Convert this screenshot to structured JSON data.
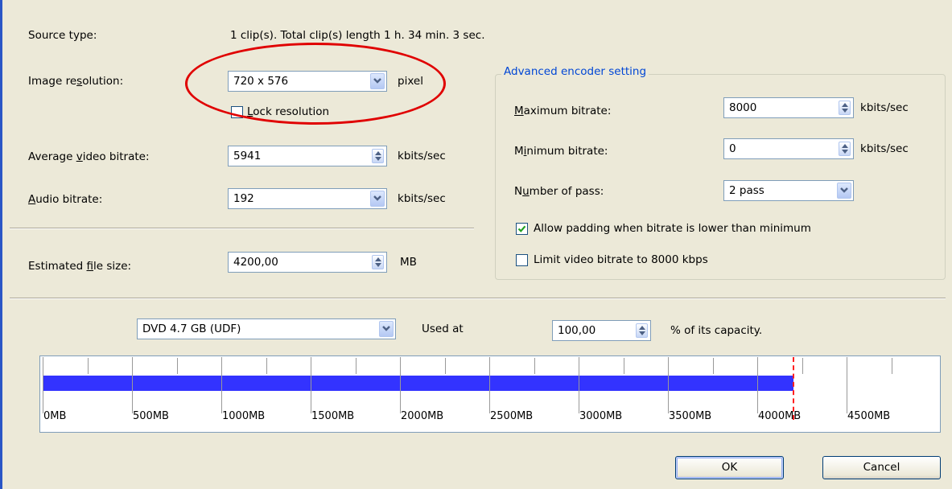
{
  "left": {
    "source_type_label": "Source type:",
    "source_type_value": "1 clip(s).  Total clip(s) length 1 h. 34 min. 3 sec.",
    "resolution_label_pre": "Image re",
    "resolution_label_u": "s",
    "resolution_label_post": "olution:",
    "resolution_value": "720 x 576",
    "resolution_unit": "pixel",
    "lock_label_u": "L",
    "lock_label_rest": "ock resolution",
    "avg_bitrate_label_pre": "Average ",
    "avg_bitrate_label_u": "v",
    "avg_bitrate_label_post": "ideo bitrate:",
    "avg_bitrate_value": "5941",
    "avg_bitrate_unit": "kbits/sec",
    "audio_label_u": "A",
    "audio_label_rest": "udio bitrate:",
    "audio_value": "192",
    "audio_unit": "kbits/sec",
    "filesize_label_pre": "Estimated ",
    "filesize_label_u": "f",
    "filesize_label_post": "ile size:",
    "filesize_value": "4200,00",
    "filesize_unit": "MB"
  },
  "advanced": {
    "title": "Advanced encoder setting",
    "max_label_u": "M",
    "max_label_rest": "aximum bitrate:",
    "max_value": "8000",
    "max_unit": "kbits/sec",
    "min_label_pre": "M",
    "min_label_u": "i",
    "min_label_post": "nimum bitrate:",
    "min_value": "0",
    "min_unit": "kbits/sec",
    "pass_label_pre": "N",
    "pass_label_u": "u",
    "pass_label_post": "mber of pass:",
    "pass_value": "2 pass",
    "padding_label": "Allow padding when bitrate is lower than minimum",
    "padding_checked": true,
    "limit_label": "Limit video bitrate to 8000 kbps",
    "limit_checked": false
  },
  "capacity": {
    "disc_value": "DVD 4.7 GB (UDF)",
    "used_at_label": "Used at",
    "percent_value": "100,00",
    "percent_label": "% of its capacity."
  },
  "ruler": {
    "labels": [
      "0MB",
      "500MB",
      "1000MB",
      "1500MB",
      "2000MB",
      "2500MB",
      "3000MB",
      "3500MB",
      "4000MB",
      "4500MB"
    ],
    "fill_mb": 4200,
    "max_mb": 5000,
    "bar_color": "#3333ff",
    "limit_color": "#ff2020"
  },
  "buttons": {
    "ok": "OK",
    "cancel": "Cancel"
  }
}
